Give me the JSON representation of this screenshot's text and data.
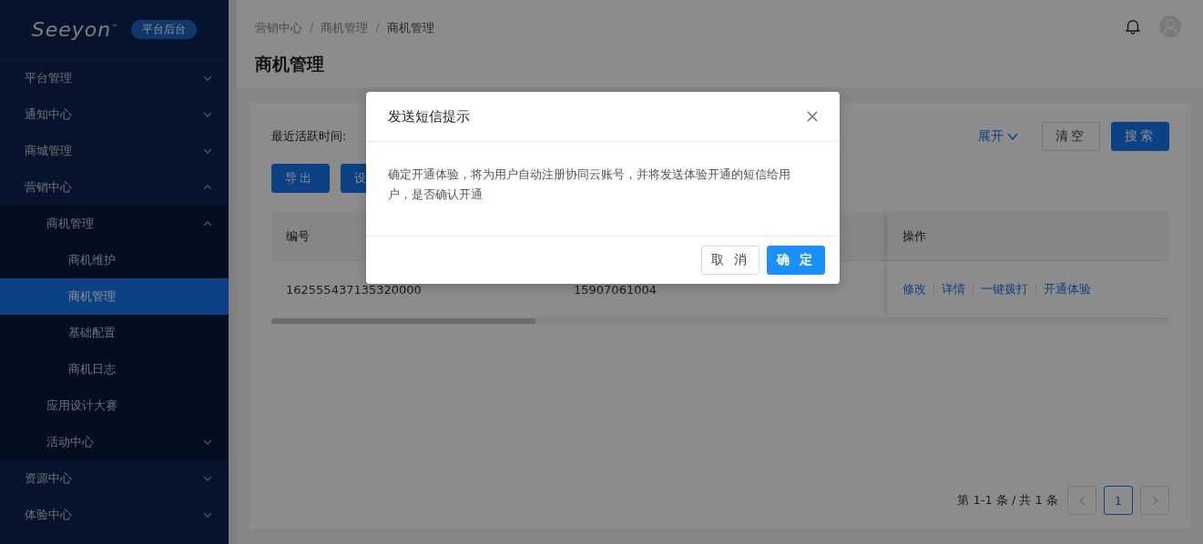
{
  "sidebar": {
    "logo": "Seeyon",
    "logo_mark": "™",
    "badge": "平台后台",
    "items": [
      {
        "label": "平台管理",
        "selected": false,
        "expanded": false
      },
      {
        "label": "通知中心",
        "selected": false,
        "expanded": false
      },
      {
        "label": "商城管理",
        "selected": false,
        "expanded": false
      },
      {
        "label": "营销中心",
        "selected": false,
        "expanded": true,
        "children": [
          {
            "label": "商机管理",
            "selected": false,
            "expanded": true,
            "children": [
              {
                "label": "商机维护",
                "selected": false
              },
              {
                "label": "商机管理",
                "selected": true
              },
              {
                "label": "基础配置",
                "selected": false
              },
              {
                "label": "商机日志",
                "selected": false
              }
            ]
          },
          {
            "label": "应用设计大赛",
            "selected": false
          },
          {
            "label": "活动中心",
            "selected": false,
            "expanded": false
          }
        ]
      },
      {
        "label": "资源中心",
        "selected": false,
        "expanded": false
      },
      {
        "label": "体验中心",
        "selected": false,
        "expanded": false
      }
    ]
  },
  "header": {
    "breadcrumb": [
      "营销中心",
      "商机管理",
      "商机管理"
    ],
    "breadcrumb_separator": "/",
    "title": "商机管理"
  },
  "filter": {
    "label": "最近活跃时间:",
    "expand": "展开",
    "clear": "清空",
    "search": "搜索"
  },
  "toolbar": [
    "导出",
    "设"
  ],
  "table": {
    "columns": {
      "id": "编号",
      "actions": "操作"
    },
    "rows": [
      {
        "id": "162555437135320000",
        "column_2": "15907061004",
        "actions": [
          "修改",
          "详情",
          "一键拨打",
          "开通体验"
        ]
      }
    ]
  },
  "pagination": {
    "summary": "第 1-1 条 / 共 1 条",
    "pages": [
      {
        "label": "1",
        "selected": true
      }
    ]
  },
  "dialog": {
    "title": "发送短信提示",
    "message": "确定开通体验，将为用户自动注册协同云账号，并将发送体验开通的短信给用户，是否确认开通",
    "cancel": "取 消",
    "ok": "确 定"
  }
}
